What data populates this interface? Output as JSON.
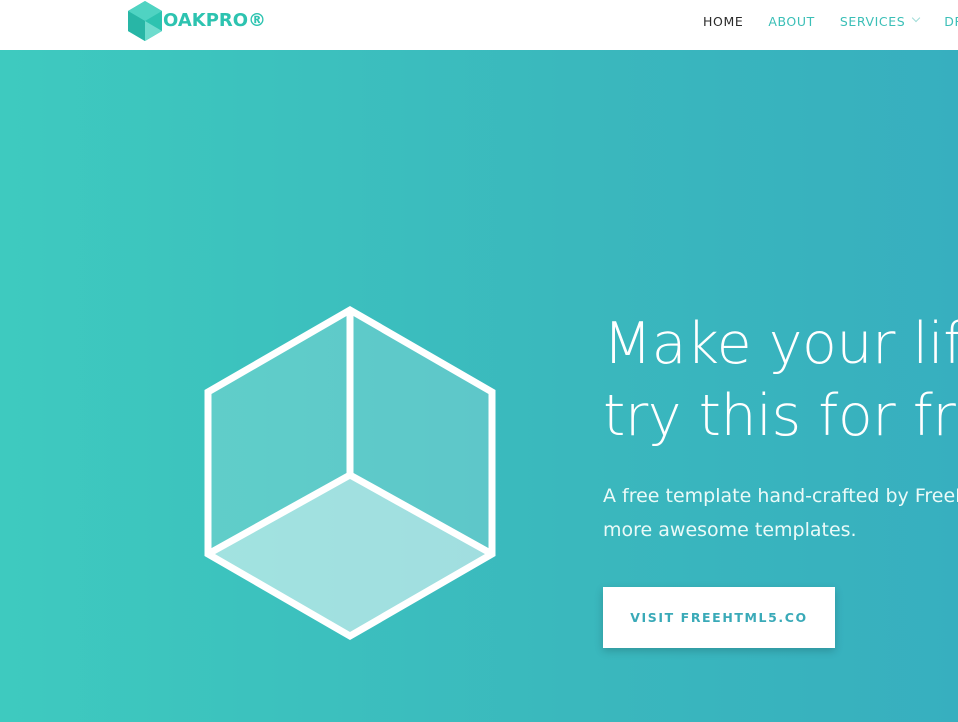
{
  "brand": {
    "logo_text": "OAKPRO®",
    "icon": "hexagon-cube-icon",
    "color": "#2dc3b0"
  },
  "nav": {
    "items": [
      {
        "label": "HOME",
        "active": true
      },
      {
        "label": "ABOUT",
        "active": false
      },
      {
        "label": "SERVICES",
        "active": false,
        "dropdown": true
      },
      {
        "label": "DR",
        "active": false
      }
    ]
  },
  "hero": {
    "title_line1": "Make your life",
    "title_line2": "try this for free",
    "subtitle_line1": "A free template hand-crafted by FreeH",
    "subtitle_line2": "more awesome templates.",
    "cta_label": "VISIT FREEHTML5.CO",
    "illustration": "cube-outline-icon",
    "gradient_start": "#3ecabf",
    "gradient_end": "#37afbf"
  },
  "colors": {
    "accent": "#3bbfb7",
    "nav_active": "#2b2b2b",
    "cta_text": "#3aaab8"
  }
}
